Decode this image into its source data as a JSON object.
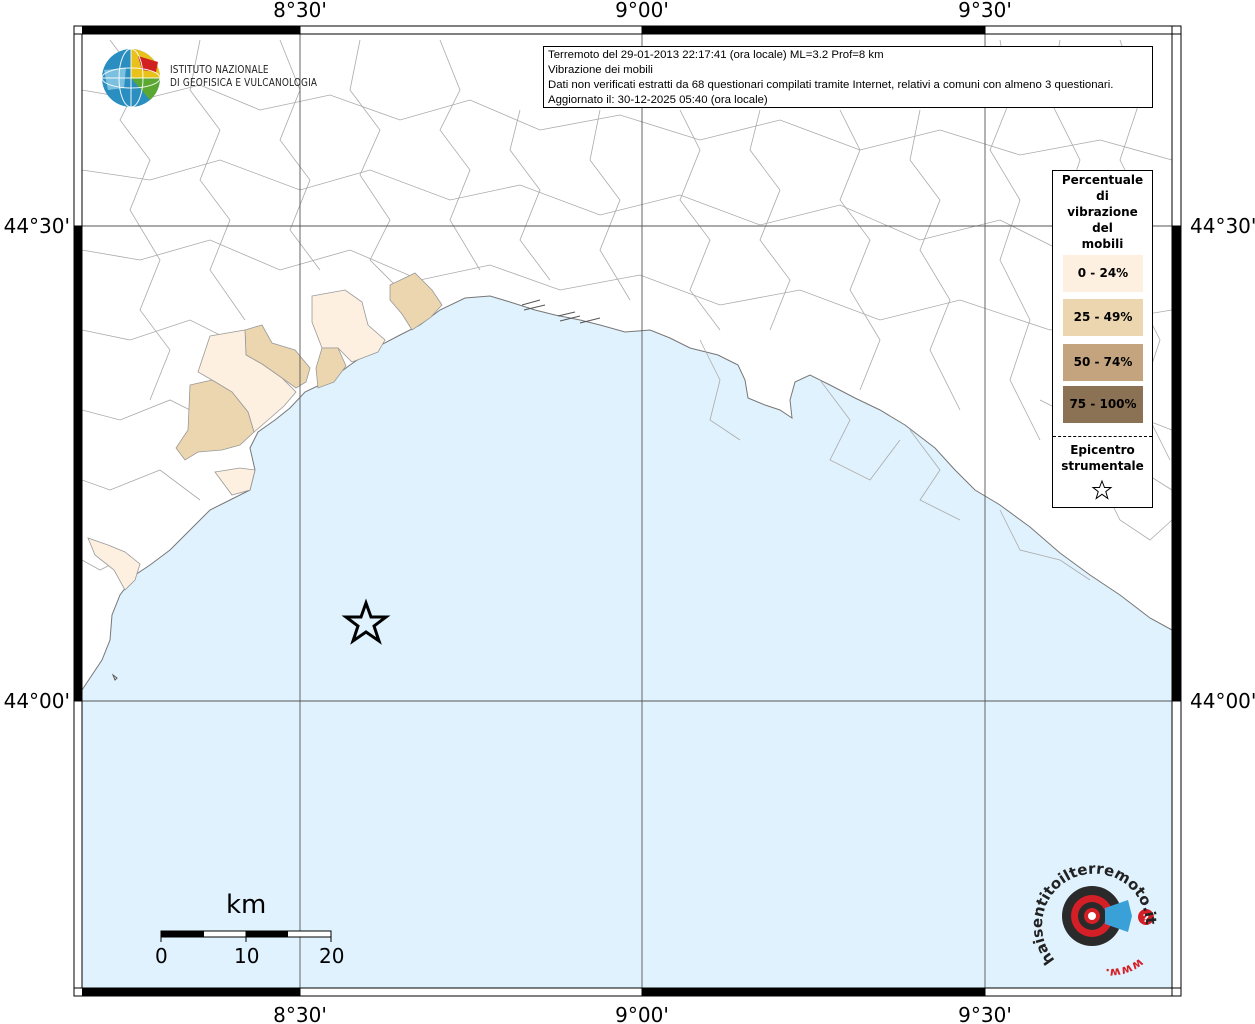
{
  "info": {
    "line1": "Terremoto del 29-01-2013 22:17:41 (ora locale) ML=3.2 Prof=8 km",
    "line2": "Vibrazione dei mobili",
    "line3": "Dati non verificati estratti da 68 questionari compilati tramite Internet, relativi a comuni con almeno 3 questionari.",
    "line4": "Aggiornato il: 30-12-2025 05:40 (ora locale)"
  },
  "axes": {
    "top_labels": [
      "8°30'",
      "9°00'",
      "9°30'"
    ],
    "bottom_labels": [
      "8°30'",
      "9°00'",
      "9°30'"
    ],
    "left_labels": [
      "44°30'",
      "44°00'"
    ],
    "right_labels": [
      "44°30'",
      "44°00'"
    ]
  },
  "legend": {
    "title_lines": [
      "Percentuale",
      "di",
      "vibrazione",
      "del",
      "mobili"
    ],
    "classes": [
      {
        "label": "0 - 24%",
        "color": "#fdf0e0"
      },
      {
        "label": "25 - 49%",
        "color": "#ecd6b0"
      },
      {
        "label": "50 - 74%",
        "color": "#c4a47e"
      },
      {
        "label": "75 - 100%",
        "color": "#8c7254"
      }
    ],
    "epicenter_lines": [
      "Epicentro",
      "strumentale"
    ]
  },
  "logo_ingv": {
    "line1": "ISTITUTO NAZIONALE",
    "line2": "DI GEOFISICA E VULCANOLOGIA"
  },
  "logo_hsit": {
    "text": "haisentitoilterremoto.it",
    "prefix": "www."
  },
  "scale_bar": {
    "title": "km",
    "labels": [
      "0",
      "10",
      "20"
    ]
  },
  "colors": {
    "sea": "#e0f2fd",
    "land": "#ffffff",
    "boundary": "#aaaaaa"
  }
}
